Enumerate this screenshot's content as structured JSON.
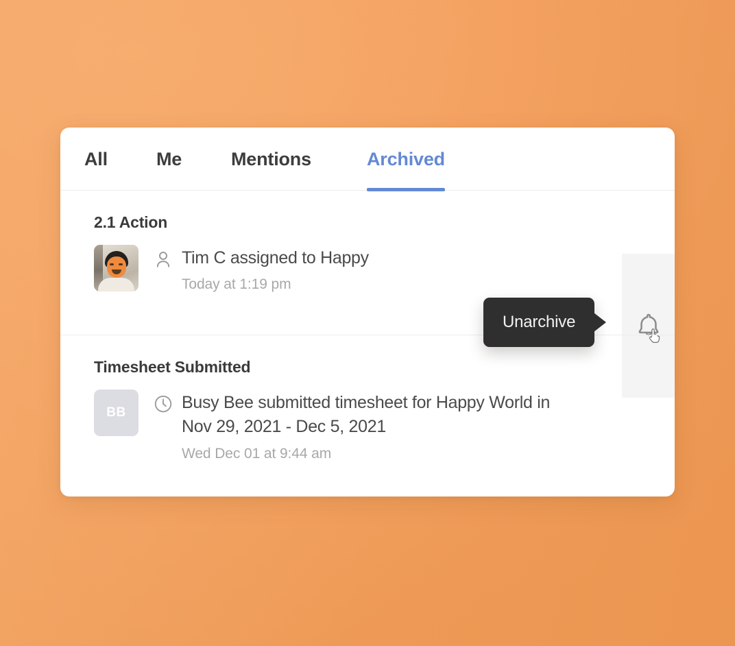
{
  "background": {
    "accent_orange": "#f4a262"
  },
  "card": {
    "tabs": [
      {
        "id": "all",
        "label": "All",
        "active": false
      },
      {
        "id": "me",
        "label": "Me",
        "active": false
      },
      {
        "id": "mentions",
        "label": "Mentions",
        "active": false
      },
      {
        "id": "archived",
        "label": "Archived",
        "active": true
      }
    ],
    "active_tab_color": "#6389d4",
    "notifications": [
      {
        "title": "2.1 Action",
        "avatar_type": "photo",
        "icon": "person-icon",
        "message": "Tim C assigned to Happy",
        "timestamp": "Today at 1:19 pm"
      },
      {
        "title": "Timesheet Submitted",
        "avatar_type": "initials",
        "avatar_initials": "BB",
        "icon": "clock-icon",
        "message": "Busy Bee submitted timesheet for Happy World in Nov 29, 2021 - Dec 5, 2021",
        "timestamp": "Wed Dec 01 at 9:44 am"
      }
    ],
    "action_strip": {
      "icon": "bell-icon",
      "cursor": "pointer-hand-cursor"
    },
    "tooltip": {
      "label": "Unarchive",
      "background": "#2f2f2f"
    }
  }
}
